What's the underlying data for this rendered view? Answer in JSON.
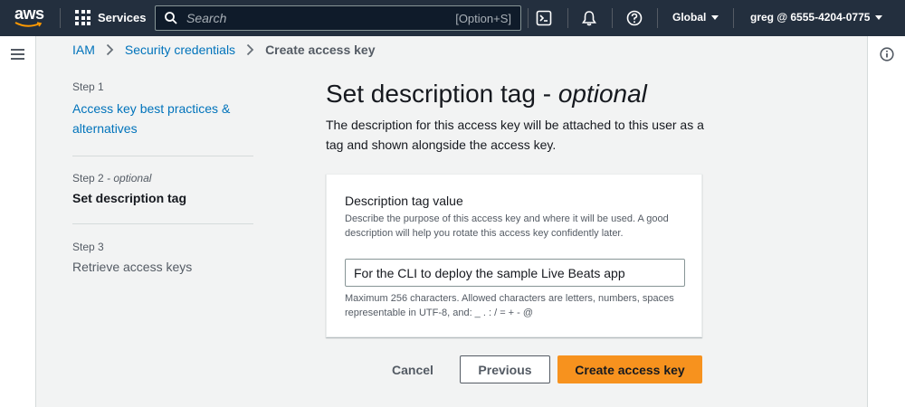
{
  "topnav": {
    "logo_text": "aws",
    "services_label": "Services",
    "search_placeholder": "Search",
    "search_shortcut": "[Option+S]",
    "region_label": "Global",
    "account_label": "greg @ 6555-4204-0775"
  },
  "breadcrumb": {
    "items": [
      "IAM",
      "Security credentials"
    ],
    "current": "Create access key"
  },
  "steps": [
    {
      "label": "Step 1",
      "label_suffix": "",
      "title": "Access key best practices & alternatives"
    },
    {
      "label": "Step 2",
      "label_suffix": " - optional",
      "title": "Set description tag"
    },
    {
      "label": "Step 3",
      "label_suffix": "",
      "title": "Retrieve access keys"
    }
  ],
  "main": {
    "title": "Set description tag - ",
    "title_suffix": "optional",
    "description": "The description for this access key will be attached to this user as a tag and shown alongside the access key."
  },
  "form": {
    "label": "Description tag value",
    "description": "Describe the purpose of this access key and where it will be used. A good description will help you rotate this access key confidently later.",
    "value": "For the CLI to deploy the sample Live Beats app",
    "constraint": "Maximum 256 characters. Allowed characters are letters, numbers, spaces representable in UTF-8, and: _ . : / = + - @"
  },
  "actions": {
    "cancel": "Cancel",
    "previous": "Previous",
    "primary": "Create access key"
  },
  "colors": {
    "nav_bg": "#232f3e",
    "link": "#0073bb",
    "primary_button": "#f7921e",
    "smile": "#ff9900"
  },
  "icons": {
    "services": "grid-icon",
    "search": "search-icon",
    "cloudshell": "cloudshell-icon",
    "notifications": "bell-icon",
    "help": "help-icon",
    "menu": "hamburger-icon",
    "info": "info-icon"
  }
}
